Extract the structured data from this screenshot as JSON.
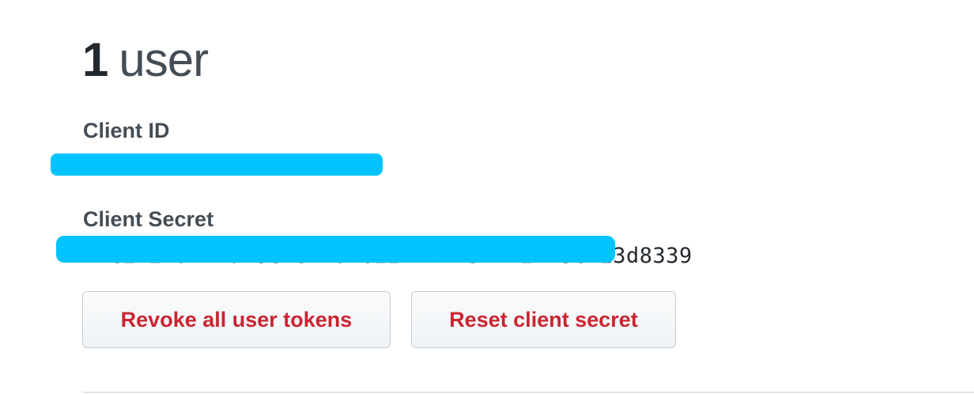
{
  "user_summary": {
    "count": "1",
    "unit": "user"
  },
  "client_id": {
    "label": "Client ID"
  },
  "client_secret": {
    "label": "Client Secret",
    "visible_value": "71c2b27ab47a43eb6bdab62271f1b574b2413cb23d8339"
  },
  "actions": {
    "revoke_label": "Revoke all user tokens",
    "reset_label": "Reset client secret"
  },
  "colors": {
    "danger_text": "#cb2431",
    "redaction": "#00c3ff",
    "heading_text": "#24292e",
    "label_text": "#444d56"
  }
}
